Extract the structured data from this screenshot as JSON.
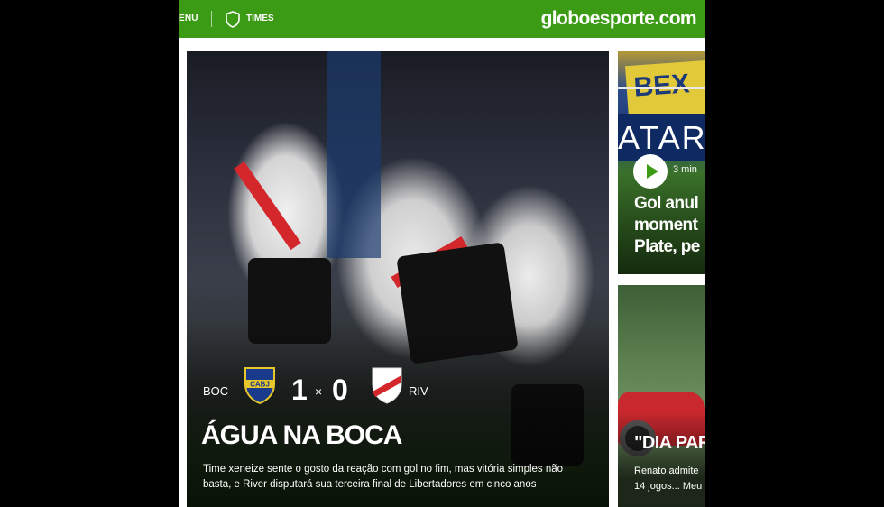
{
  "header": {
    "menu_label": "ENU",
    "times_label": "TIMES",
    "logo": "globoesporte.com",
    "brand_color": "#3c9b14"
  },
  "main_story": {
    "home_team": "BOC",
    "home_score": "1",
    "score_separator": "×",
    "away_score": "0",
    "away_team": "RIV",
    "home_crest_text": "CABJ",
    "headline": "ÁGUA NA BOCA",
    "summary": "Time xeneize sente o gosto da reação com gol no fim, mas vitória simples não basta, e River disputará sua terceira final de Libertadores em cinco anos"
  },
  "side_stories": [
    {
      "duration": "3 min",
      "title": "Gol anul\nmoment\nPlate, pe",
      "icon": "play-icon"
    },
    {
      "title": "\"DIA PAR",
      "summary": "Renato admite\n14 jogos... Meu"
    }
  ]
}
